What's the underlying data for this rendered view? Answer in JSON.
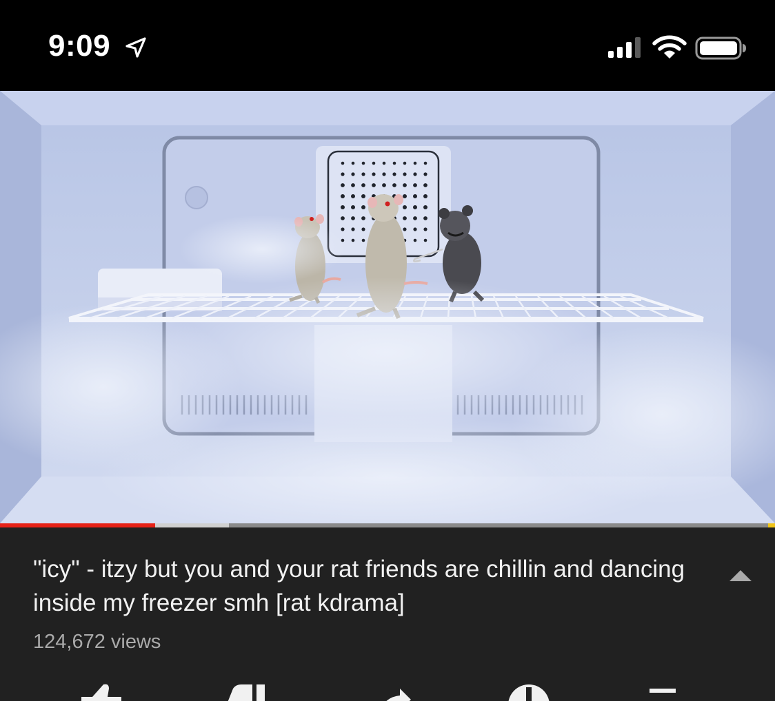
{
  "status_bar": {
    "time": "9:09",
    "icons": [
      "location-arrow-icon",
      "cellular-signal-icon",
      "wifi-icon",
      "battery-icon"
    ]
  },
  "player": {
    "progress_played": 0.2,
    "progress_buffered": 0.295,
    "progress_color": "#e62117",
    "buffer_color": "#d0d0d0"
  },
  "video": {
    "title": "\"icy\" - itzy but you and your rat friends are chillin and dancing inside my freezer smh [rat kdrama]",
    "views": "124,672 views"
  },
  "actions": {
    "icons": [
      "thumbs-up-icon",
      "thumbs-down-icon",
      "share-icon",
      "download-icon",
      "save-icon"
    ]
  },
  "colors": {
    "background": "#212121",
    "title_text": "#f1f1f1",
    "secondary_text": "#aaaaaa"
  }
}
